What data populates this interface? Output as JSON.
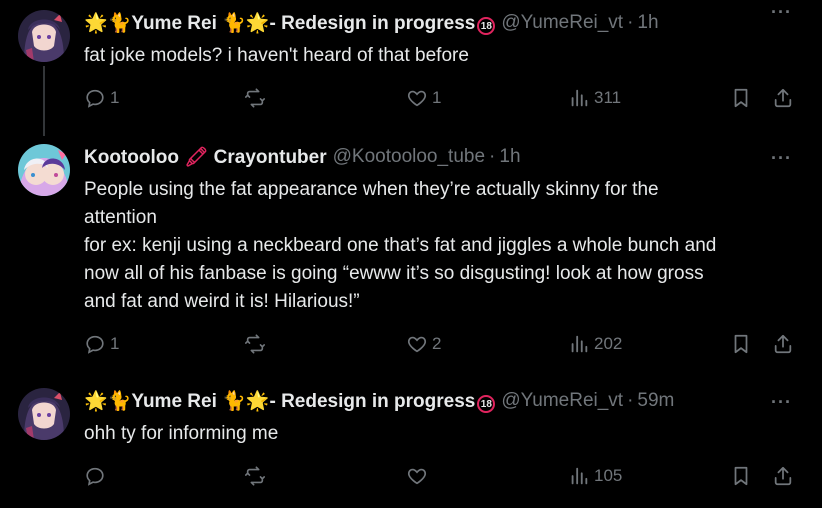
{
  "tweets": [
    {
      "name_prefix": "🌟🐈",
      "name": "Yume Rei",
      "name_mid": "🐈🌟",
      "name_suffix": "- Redesign in progress",
      "name_badge": "18",
      "handle": "@YumeRei_vt",
      "time": "1h",
      "text_lines": [
        "fat joke models? i haven't heard of that before"
      ],
      "reply_count": "1",
      "retweet_count": "",
      "like_count": "1",
      "view_count": "311"
    },
    {
      "name": "Kootooloo",
      "name_mid": "🖍",
      "name_suffix": "Crayontuber",
      "handle": "@Kootooloo_tube",
      "time": "1h",
      "text_lines": [
        "People using the fat appearance when they’re actually skinny for the",
        "attention",
        "for ex: kenji using a neckbeard one that’s fat and jiggles a whole bunch and",
        "now all of his fanbase is going “ewww it’s so disgusting! look at how gross",
        "and fat and weird it is! Hilarious!”"
      ],
      "reply_count": "1",
      "retweet_count": "",
      "like_count": "2",
      "view_count": "202"
    },
    {
      "name_prefix": "🌟🐈",
      "name": "Yume Rei",
      "name_mid": "🐈🌟",
      "name_suffix": "- Redesign in progress",
      "name_badge": "18",
      "handle": "@YumeRei_vt",
      "time": "59m",
      "text_lines": [
        "ohh ty for informing me"
      ],
      "reply_count": "",
      "retweet_count": "",
      "like_count": "",
      "view_count": "105"
    }
  ],
  "dot": "·",
  "more_label": "···",
  "colors": {
    "background": "#000000",
    "text": "#e7e9ea",
    "muted": "#71767b",
    "thread_line": "#333639"
  }
}
